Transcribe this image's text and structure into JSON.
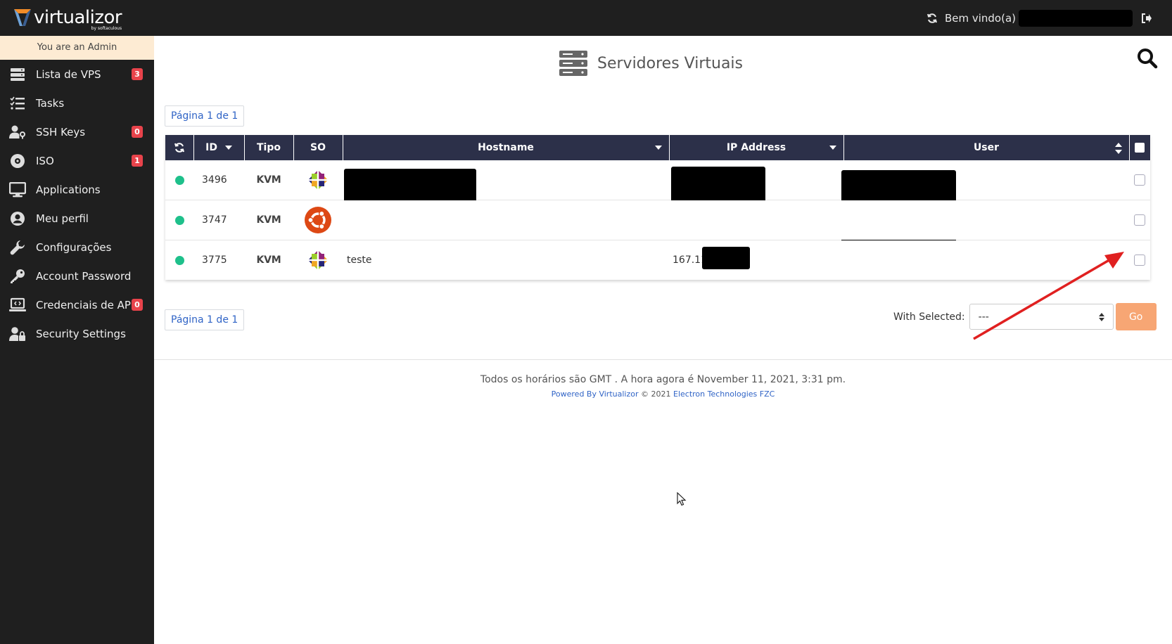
{
  "app": {
    "name": "virtualizor",
    "byline": "by softaculous"
  },
  "header": {
    "welcome": "Bem vindo(a)"
  },
  "sidebar": {
    "admin_note": "You are an Admin",
    "items": [
      {
        "label": "Lista de VPS",
        "icon": "server-list-icon",
        "badge": "3"
      },
      {
        "label": "Tasks",
        "icon": "task-list-icon",
        "badge": null
      },
      {
        "label": "SSH Keys",
        "icon": "user-key-icon",
        "badge": "0"
      },
      {
        "label": "ISO",
        "icon": "disc-icon",
        "badge": "1"
      },
      {
        "label": "Applications",
        "icon": "monitor-icon",
        "badge": null
      },
      {
        "label": "Meu perfil",
        "icon": "user-circle-icon",
        "badge": null
      },
      {
        "label": "Configurações",
        "icon": "wrench-icon",
        "badge": null
      },
      {
        "label": "Account Password",
        "icon": "key-icon",
        "badge": null
      },
      {
        "label": "Credenciais de API",
        "icon": "laptop-code-icon",
        "badge": "0"
      },
      {
        "label": "Security Settings",
        "icon": "user-lock-icon",
        "badge": null
      }
    ]
  },
  "main": {
    "title": "Servidores Virtuais",
    "pager_label": "Página 1 de 1",
    "table": {
      "columns": [
        "ID",
        "Tipo",
        "SO",
        "Hostname",
        "IP Address",
        "User"
      ],
      "rows": [
        {
          "id": "3496",
          "type": "KVM",
          "os": "centos",
          "hostname": "",
          "ip": ""
        },
        {
          "id": "3747",
          "type": "KVM",
          "os": "ubuntu",
          "hostname": "",
          "ip": ""
        },
        {
          "id": "3775",
          "type": "KVM",
          "os": "centos",
          "hostname": "teste",
          "ip": "167.114"
        }
      ]
    },
    "with_selected": {
      "label": "With Selected:",
      "value": "---",
      "go": "Go"
    }
  },
  "footer": {
    "line1": "Todos os horários são GMT . A hora agora é November 11, 2021, 3:31 pm.",
    "powered": "Powered By Virtualizor",
    "copyright": "© 2021",
    "company": "Electron Technologies FZC"
  },
  "colors": {
    "header_bg": "#2c3049",
    "sidebar_bg": "#1f1f1f",
    "status_online": "#1ec08b",
    "badge": "#e8434b",
    "go_button": "#f7a674",
    "link": "#3064c6"
  }
}
